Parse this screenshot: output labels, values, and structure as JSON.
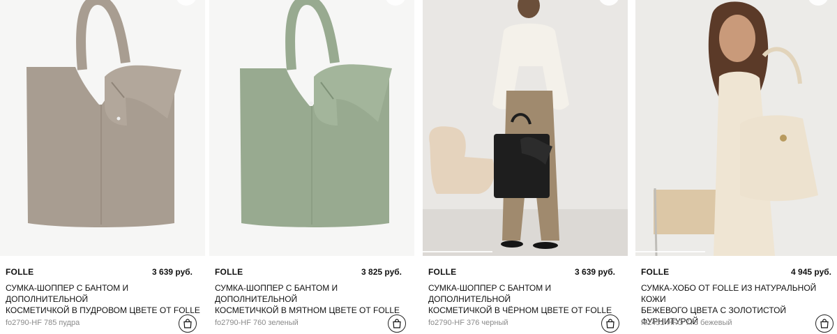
{
  "products": [
    {
      "brand": "FOLLE",
      "price": "3 639 руб.",
      "title_line1": "СУМКА-ШОППЕР С БАНТОМ И ДОПОЛНИТЕЛЬНОЙ",
      "title_line2": "КОСМЕТИЧКОЙ В ПУДРОВОМ ЦВЕТЕ ОТ FOLLE",
      "article": "fo2790-HF 785 пудра",
      "bag_color": "#a89d91",
      "bg_color": "#f5f5f4"
    },
    {
      "brand": "FOLLE",
      "price": "3 825 руб.",
      "title_line1": "СУМКА-ШОППЕР С БАНТОМ И ДОПОЛНИТЕЛЬНОЙ",
      "title_line2": "КОСМЕТИЧКОЙ В МЯТНОМ ЦВЕТЕ ОТ FOLLE",
      "article": "fo2790-HF 760 зеленый",
      "bag_color": "#98aa90",
      "bg_color": "#f5f5f4"
    },
    {
      "brand": "FOLLE",
      "price": "3 639 руб.",
      "title_line1": "СУМКА-ШОППЕР С БАНТОМ И ДОПОЛНИТЕЛЬНОЙ",
      "title_line2": "КОСМЕТИЧКОЙ В ЧЁРНОМ ЦВЕТЕ ОТ FOLLE",
      "article": "fo2790-HF 376 черный",
      "bag_color": "#1e1e1e",
      "bg_color": "#e9e7e4"
    },
    {
      "brand": "FOLLE",
      "price": "4 945 руб.",
      "title_line1": "СУМКА-ХОБО ОТ FOLLE ИЗ НАТУРАЛЬНОЙ КОЖИ",
      "title_line2": "БЕЖЕВОГО ЦВЕТА С ЗОЛОТИСТОЙ ФУРНИТУРОЙ",
      "article": "fo2451-HFG 778 бежевый",
      "bag_color": "#ede2cf",
      "bg_color": "#eceae7"
    }
  ],
  "icons": {
    "cart": "shopping-bag-icon",
    "favorite": "heart-icon"
  }
}
